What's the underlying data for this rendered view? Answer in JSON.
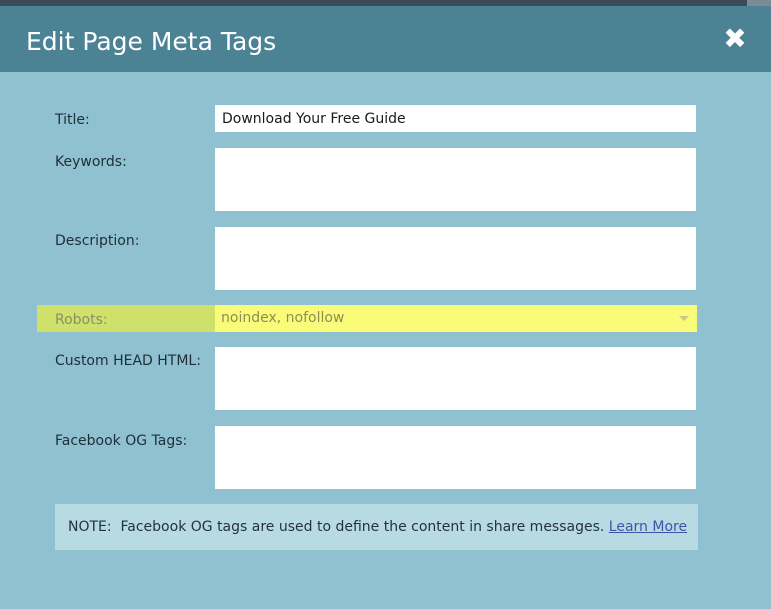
{
  "dialog": {
    "title": "Edit Page Meta Tags",
    "close_symbol": "✖",
    "close_icon": "close-icon"
  },
  "fields": {
    "title_label": "Title:",
    "title_value": "Download Your Free Guide",
    "keywords_label": "Keywords:",
    "keywords_value": "",
    "description_label": "Description:",
    "description_value": "",
    "robots_label": "Robots:",
    "robots_value": "noindex, nofollow",
    "custom_head_label": "Custom HEAD HTML:",
    "custom_head_value": "",
    "facebook_og_label": "Facebook OG Tags:",
    "facebook_og_value": ""
  },
  "note": {
    "prefix": "NOTE:",
    "text": "Facebook OG tags are used to define the content in share messages.",
    "link": "Learn More"
  },
  "colors": {
    "header": "#4b8294",
    "body": "#8fc1d1",
    "highlight": "#fbfb7a",
    "note_bg": "#b8dbe3",
    "link": "#3a56a8"
  }
}
